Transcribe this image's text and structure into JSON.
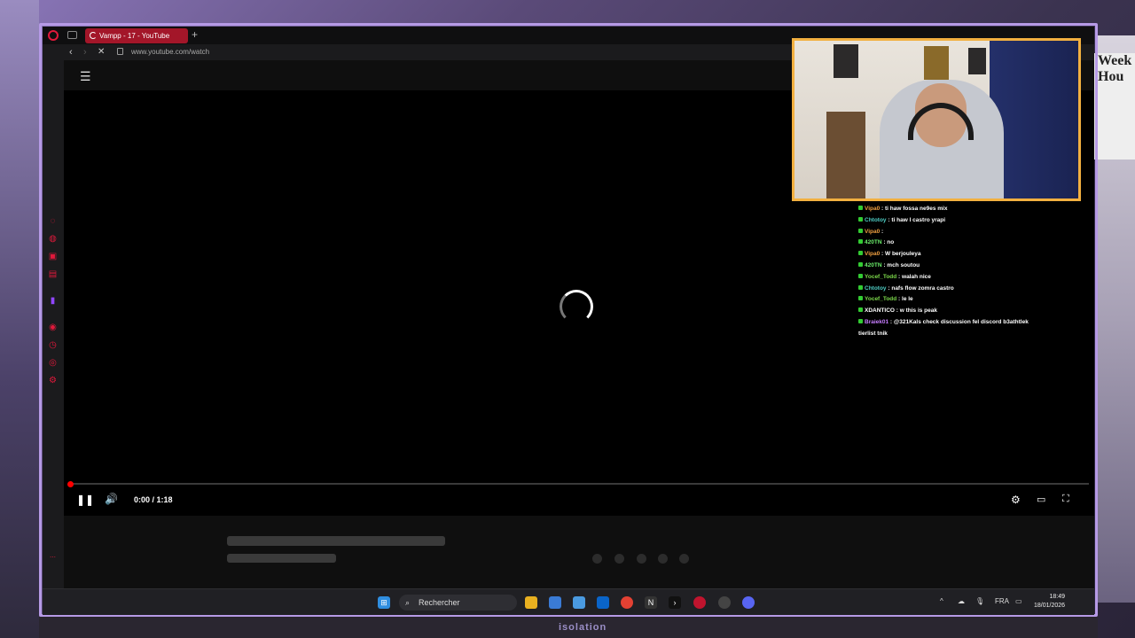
{
  "browser": {
    "tab_title": "Vampp - 17 - YouTube",
    "new_tab": "+",
    "url": "www.youtube.com/watch"
  },
  "player": {
    "time": "0:00 / 1:18",
    "progress": 0
  },
  "taskbar": {
    "search_label": "Rechercher",
    "language": "FRA",
    "time": "18:49",
    "date": "18/01/2026"
  },
  "chat": [
    {
      "user": "Vipa0",
      "color": "#f0a040",
      "msg": "ti haw fossa ne9es mix"
    },
    {
      "user": "Chtotoy",
      "color": "#4ecdc4",
      "msg": "ti haw l castro yrapi"
    },
    {
      "user": "Vipa0",
      "color": "#f0a040",
      "msg": ""
    },
    {
      "user": "420TN",
      "color": "#6cf06c",
      "msg": "no"
    },
    {
      "user": "Vipa0",
      "color": "#f0a040",
      "msg": "W berjouleya"
    },
    {
      "user": "420TN",
      "color": "#6cf06c",
      "msg": "mch soutou"
    },
    {
      "user": "Yocef_Todd",
      "color": "#7cd84a",
      "msg": "walah nice"
    },
    {
      "user": "Chtotoy",
      "color": "#4ecdc4",
      "msg": "nafs flow zomra castro"
    },
    {
      "user": "Yocef_Todd",
      "color": "#7cd84a",
      "msg": "le le"
    },
    {
      "user": "XDANTICO",
      "color": "#ffffff",
      "msg": "w this is peak"
    },
    {
      "user": "Braiek01",
      "color": "#c77dff",
      "msg": "@321Kals check discussion fel discord b3athtlek"
    },
    {
      "user": "",
      "color": "#ffffff",
      "msg": "tierlist tnik"
    }
  ],
  "background": {
    "sticker": "isolation",
    "poster": "Week Hou"
  }
}
